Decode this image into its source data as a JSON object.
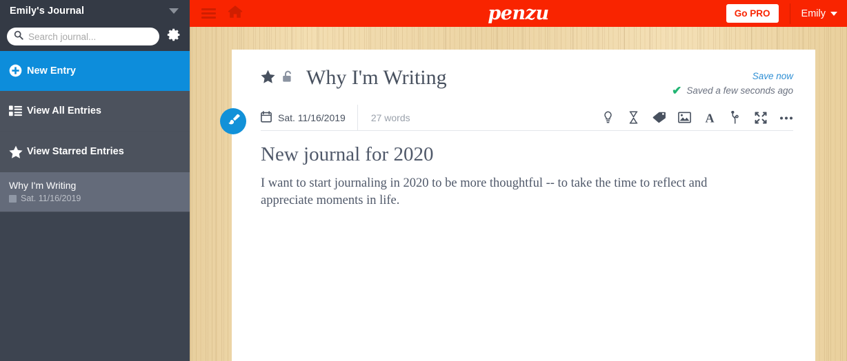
{
  "sidebar": {
    "journal_title": "Emily's Journal",
    "collapse_icon": "chevron-down-icon",
    "search": {
      "placeholder": "Search journal...",
      "value": "",
      "icon": "search-icon"
    },
    "settings_icon": "gear-icon",
    "nav": [
      {
        "label": "New Entry",
        "icon": "plus-circle-icon"
      },
      {
        "label": "View All Entries",
        "icon": "list-icon"
      },
      {
        "label": "View Starred Entries",
        "icon": "star-icon"
      }
    ],
    "entries": [
      {
        "title": "Why I'm Writing",
        "date": "Sat. 11/16/2019",
        "icon": "notebook-icon"
      }
    ]
  },
  "header": {
    "menu_icon": "hamburger-icon",
    "home_icon": "home-icon",
    "logo": "penzu",
    "go_pro_label": "Go PRO",
    "user_name": "Emily",
    "user_caret_icon": "caret-down-icon",
    "brand_color": "#f92400"
  },
  "document": {
    "star_icon": "star-icon",
    "lock_icon": "unlocked-padlock-icon",
    "title": "Why I'm Writing",
    "save_now_label": "Save now",
    "saved_status": "Saved a few seconds ago",
    "saved_check_icon": "check-icon",
    "toolbar": {
      "calendar_icon": "calendar-icon",
      "date": "Sat. 11/16/2019",
      "word_count": "27 words",
      "icons": [
        "lightbulb-icon",
        "hourglass-icon",
        "tag-icon",
        "image-icon",
        "font-icon",
        "pin-icon",
        "fullscreen-icon",
        "ellipsis-icon"
      ]
    },
    "body_heading": "New journal for 2020",
    "body_paragraph": "I want to start journaling in 2020 to be more thoughtful -- to take the time to reflect and appreciate moments in life.",
    "paint_button_icon": "paintbrush-icon"
  },
  "colors": {
    "brand_red": "#f92400",
    "accent_blue": "#0d8ddb",
    "sidebar_bg": "#3d4450",
    "check_green": "#21b573",
    "link_blue": "#2f8fd4"
  }
}
